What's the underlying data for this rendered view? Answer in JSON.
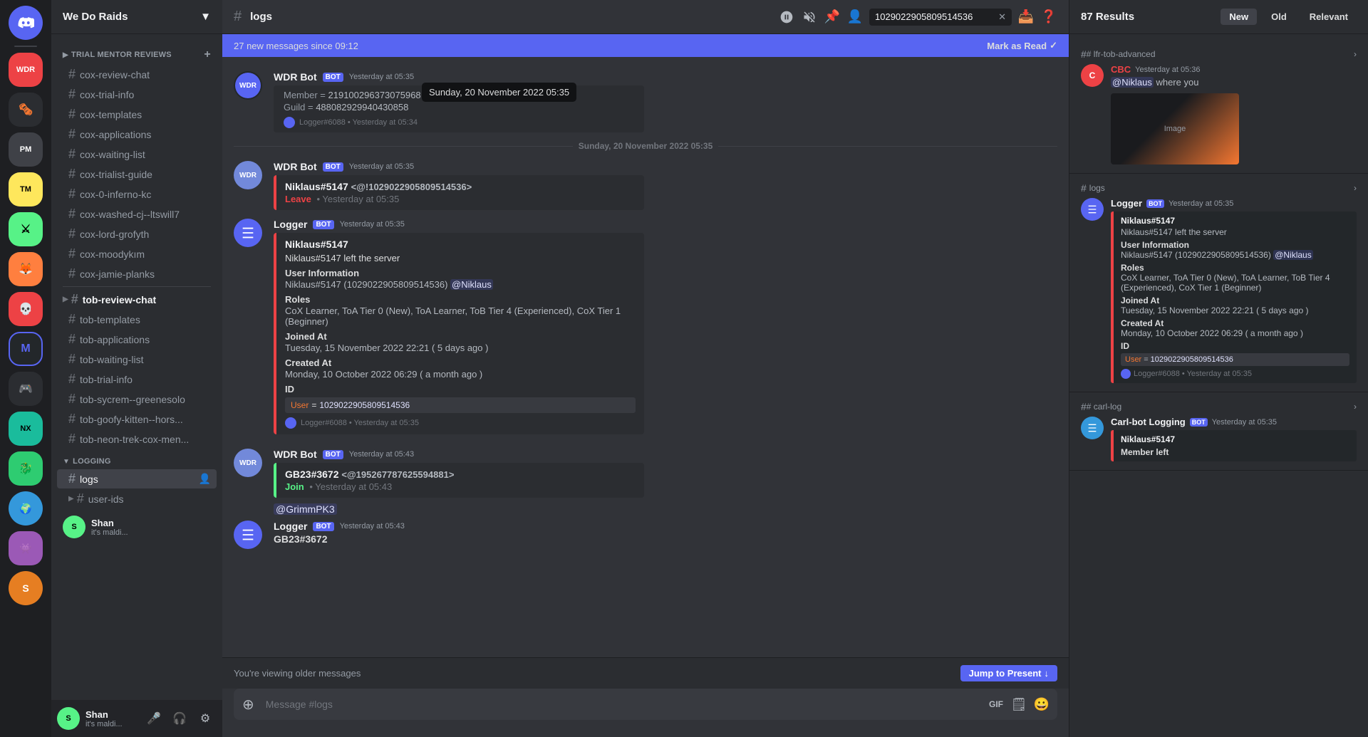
{
  "window_title": "Discord",
  "server": {
    "name": "We Do Raids",
    "chevron": "▼"
  },
  "categories": [
    {
      "name": "TRIAL MENTOR REVIEWS",
      "channels": [
        {
          "name": "cox-review-chat",
          "active": false
        },
        {
          "name": "cox-trial-info",
          "active": false
        },
        {
          "name": "cox-templates",
          "active": false
        },
        {
          "name": "cox-applications",
          "active": false
        },
        {
          "name": "cox-waiting-list",
          "active": false
        },
        {
          "name": "cox-trialist-guide",
          "active": false
        },
        {
          "name": "cox-0-inferno-kc",
          "active": false
        },
        {
          "name": "cox-washed-cj--ltswill7",
          "active": false
        },
        {
          "name": "cox-lord-grofyth",
          "active": false
        },
        {
          "name": "cox-moodykım",
          "active": false
        },
        {
          "name": "cox-jamie-planks",
          "active": false
        }
      ]
    },
    {
      "name": "",
      "channels": [
        {
          "name": "tob-review-chat",
          "active": false,
          "bold": true
        },
        {
          "name": "tob-templates",
          "active": false
        },
        {
          "name": "tob-applications",
          "active": false
        },
        {
          "name": "tob-waiting-list",
          "active": false
        },
        {
          "name": "tob-trial-info",
          "active": false
        },
        {
          "name": "tob-sycrem--greenesolo",
          "active": false
        },
        {
          "name": "tob-goofy-kitten--hors...",
          "active": false
        },
        {
          "name": "tob-neon-trek-cox-men...",
          "active": false
        }
      ]
    },
    {
      "name": "LOGGING",
      "channels": [
        {
          "name": "logs",
          "active": true
        },
        {
          "name": "user-ids",
          "active": false
        }
      ]
    }
  ],
  "channel": {
    "name": "logs",
    "hash": "#"
  },
  "header_actions": [
    "🔔",
    "📌",
    "👤",
    "🔍",
    "❓"
  ],
  "search_query": "1029022905809514536",
  "new_messages_banner": {
    "text": "27 new messages since 09:12",
    "action": "Mark as Read",
    "icon": "✓"
  },
  "messages": [
    {
      "id": "wdr_leave",
      "type": "wdr",
      "author": "WDR Bot",
      "author_color": "#f2f3f5",
      "is_bot": true,
      "bot_label": "BOT",
      "timestamp": "Yesterday at 05:35",
      "embed": {
        "color": "red",
        "tag": "Leave",
        "tag_type": "leave",
        "mention": "Niklaus#5147",
        "mention_id": "<@!1029022905809514536>",
        "subtitle": "Yesterday at 05:35",
        "member": "Member = 219100296373075968",
        "guild": "Guild = 488082929940430858"
      },
      "logger_footer": "Logger#6088 • Yesterday at 05:34",
      "date_between": "Sunday, 20 November 2022 05:35"
    },
    {
      "id": "logger_leave",
      "type": "logger",
      "author": "Logger",
      "is_bot": true,
      "bot_label": "BOT",
      "timestamp": "Yesterday at 05:35",
      "embed": {
        "title": "Niklaus#5147",
        "description": "Niklaus#5147 left the server",
        "fields": [
          {
            "label": "User Information",
            "value": "Niklaus#5147 (1029022905809514536) @Niklaus"
          },
          {
            "label": "Roles",
            "value": "CoX Learner, ToA Tier 0 (New), ToA Learner, ToB Tier 4 (Experienced), CoX Tier 1 (Beginner)"
          },
          {
            "label": "Joined At",
            "value": "Tuesday, 15 November 2022 22:21 ( 5 days ago )"
          },
          {
            "label": "Created At",
            "value": "Monday, 10 October 2022 06:29  ( a month ago )"
          },
          {
            "label": "ID",
            "value": ""
          }
        ],
        "id_row": {
          "key": "User",
          "eq": "=",
          "val": "1029022905809514536"
        },
        "footer": "Logger#6088 • Yesterday at 05:35"
      }
    },
    {
      "id": "wdr_join",
      "type": "wdr",
      "author": "WDR Bot",
      "author_color": "#f2f3f5",
      "is_bot": true,
      "bot_label": "BOT",
      "timestamp": "Yesterday at 05:43",
      "embed": {
        "color": "green",
        "tag": "Join",
        "tag_type": "join",
        "mention": "GB23#3672",
        "mention_id": "<@195267787625594881>",
        "subtitle": "Yesterday at 05:43"
      }
    },
    {
      "id": "grimmPK3",
      "type": "plain_mention",
      "text": "@GrimmPK3"
    },
    {
      "id": "logger_join",
      "type": "logger_plain",
      "author": "Logger",
      "is_bot": true,
      "bot_label": "BOT",
      "timestamp": "Yesterday at 05:43",
      "text": "GB23#3672"
    }
  ],
  "older_banner": {
    "text": "You're viewing older messages",
    "action": "Jump to Present",
    "arrow": "↓"
  },
  "message_input": {
    "placeholder": "Message #logs"
  },
  "user": {
    "name": "Shan",
    "status": "it's maldi...",
    "controls": [
      "🎤",
      "🎧",
      "⚙"
    ]
  },
  "search_results": {
    "count": "87 Results",
    "filters": [
      {
        "label": "New",
        "active": true
      },
      {
        "label": "Old",
        "active": false
      },
      {
        "label": "Relevant",
        "active": false
      }
    ],
    "items": [
      {
        "channel": "# lfr-tob-advanced",
        "author": "CBC",
        "author_color": "#ed4245",
        "timestamp": "Yesterday at 05:36",
        "text_before": "@Niklaus",
        "text": "where you",
        "has_image": true
      },
      {
        "channel": "# logs",
        "author": "Logger",
        "is_bot": true,
        "bot_label": "BOT",
        "timestamp": "Yesterday at 05:35",
        "embed": {
          "title": "Niklaus#5147",
          "description": "Niklaus#5147 left the server",
          "fields": [
            {
              "label": "User Information",
              "value": "Niklaus#5147 (1029022905809514536) @Niklaus"
            },
            {
              "label": "Roles",
              "value": "CoX Learner, ToA Tier 0 (New), ToA Learner, ToB Tier 4 (Experienced), CoX Tier 1 (Beginner)"
            },
            {
              "label": "Joined At",
              "value": "Tuesday, 15 November 2022 22:21 ( 5 days ago )"
            },
            {
              "label": "Created At",
              "value": "Monday, 10 October 2022 06:29 ( a month ago )"
            },
            {
              "label": "ID",
              "value": ""
            }
          ],
          "id_row": {
            "key": "User",
            "eq": "=",
            "val": "1029022905809514536"
          },
          "footer": "Logger#6088 • Yesterday at 05:35"
        }
      },
      {
        "channel": "# carl-log",
        "author": "Carl-bot Logging",
        "is_bot": true,
        "bot_label": "BOT",
        "timestamp": "Yesterday at 05:35",
        "embed_title": "Niklaus#5147",
        "embed_label": "Member left"
      }
    ]
  }
}
